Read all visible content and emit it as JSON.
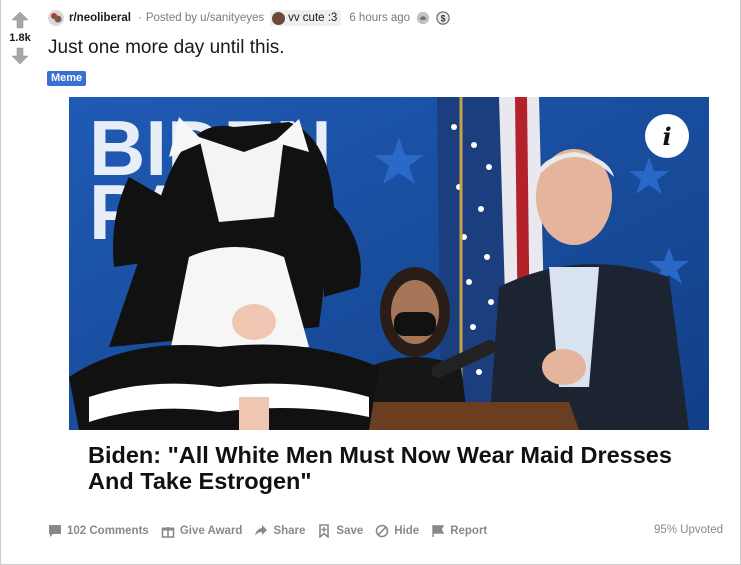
{
  "post": {
    "score": "1.8k",
    "subreddit": "r/neoliberal",
    "posted_by": "Posted by u/sanityeyes",
    "user_flair": "vv cute :3",
    "age": "6 hours ago",
    "title": "Just one more day until this.",
    "post_flair": "Meme",
    "post_flair_color": "#3a6fd4"
  },
  "media": {
    "caption_line1": "Biden: \"All White Men Must Now Wear Maid Dresses",
    "caption_line2": "And Take Estrogen\"",
    "background_text_1": "BIDEN",
    "background_text_2": "PARIS",
    "info_glyph": "i"
  },
  "actions": {
    "comments": "102 Comments",
    "give_award": "Give Award",
    "share": "Share",
    "save": "Save",
    "hide": "Hide",
    "report": "Report",
    "upvoted": "95% Upvoted"
  }
}
